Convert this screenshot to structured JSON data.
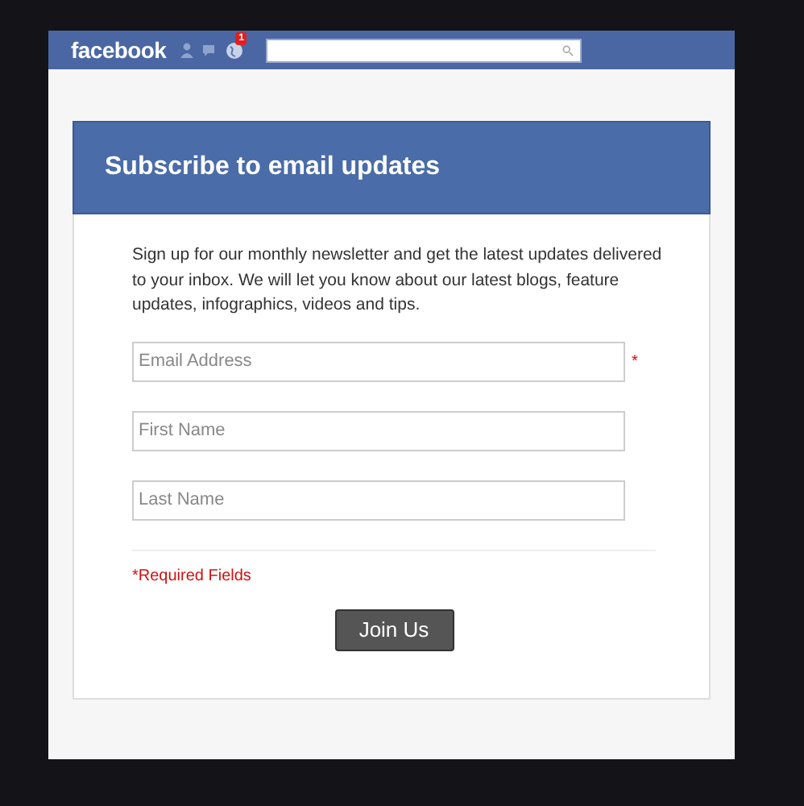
{
  "top_bar": {
    "logo": "facebook",
    "notification_count": "1"
  },
  "form": {
    "title": "Subscribe to email updates",
    "intro": "Sign up for our monthly newsletter and get the latest updates delivered to your inbox. We will let you know about our latest blogs, feature updates, infographics, videos and tips.",
    "fields": [
      {
        "placeholder": "Email Address",
        "required_mark": "*"
      },
      {
        "placeholder": "First Name"
      },
      {
        "placeholder": "Last Name"
      }
    ],
    "required_note": "*Required Fields",
    "submit": "Join Us"
  }
}
